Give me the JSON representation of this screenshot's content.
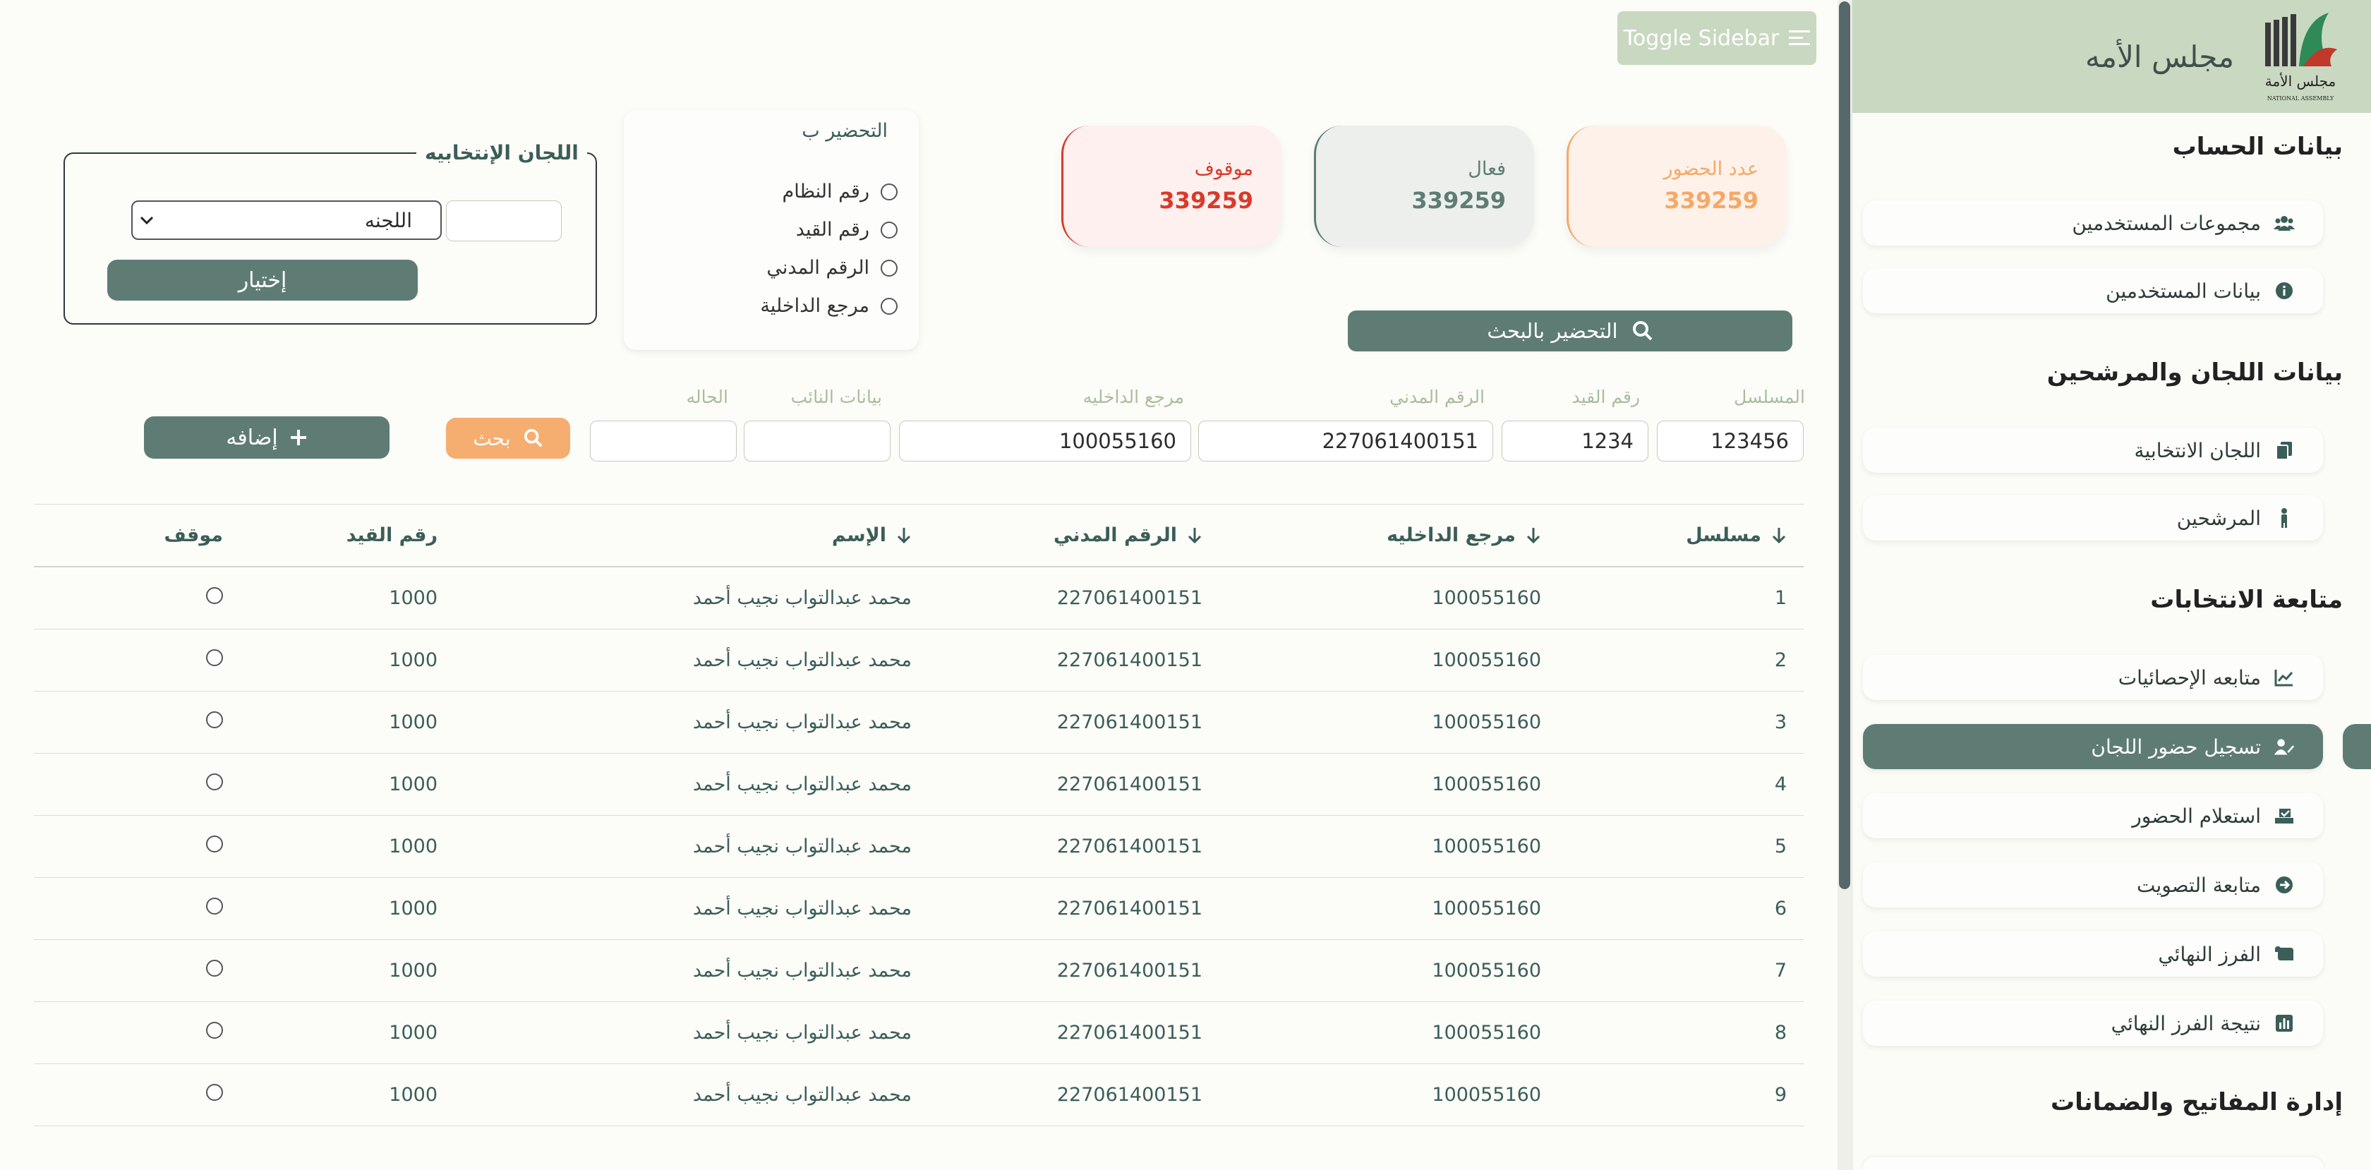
{
  "brand": {
    "title": "مجلس الأمه",
    "logo_text": "مجلس الأمة",
    "logo_subtext": "NATIONAL ASSEMBLY"
  },
  "sidebar": {
    "sections": [
      {
        "title": "بيانات الحساب"
      },
      {
        "title": "بيانات اللجان والمرشحين"
      },
      {
        "title": "متابعة الانتخابات"
      },
      {
        "title": "إدارة المفاتيح والضمانات"
      }
    ],
    "items": [
      {
        "label": "مجموعات المستخدمين",
        "icon": "users-icon"
      },
      {
        "label": "بيانات المستخدمين",
        "icon": "info-icon"
      },
      {
        "label": "اللجان الانتخابية",
        "icon": "copy-icon"
      },
      {
        "label": "المرشحين",
        "icon": "person-icon"
      },
      {
        "label": "متابعه الإحصائيات",
        "icon": "chart-line-icon"
      },
      {
        "label": "تسجيل حضور اللجان",
        "icon": "user-edit-icon",
        "active": true
      },
      {
        "label": "استعلام الحضور",
        "icon": "check-tray-icon"
      },
      {
        "label": "متابعة التصويت",
        "icon": "arrow-circle-icon"
      },
      {
        "label": "الفرز النهائي",
        "icon": "scroll-icon"
      },
      {
        "label": "نتيجة الفرز النهائي",
        "icon": "bar-chart-icon"
      }
    ]
  },
  "toolbar": {
    "toggle_label": "Toggle Sidebar"
  },
  "stats": [
    {
      "label": "عدد الحضور",
      "value": "339259",
      "color": "#f6a866"
    },
    {
      "label": "فعال",
      "value": "339259",
      "color": "#5e7c74"
    },
    {
      "label": "موقوف",
      "value": "339259",
      "color": "#d93a2b"
    }
  ],
  "search_prep_button": "التحضير بالبحث",
  "prep_by": {
    "title": "التحضير ب",
    "options": [
      "رقم النظام",
      "رقم القيد",
      "الرقم المدني",
      "مرجع الداخلية"
    ]
  },
  "committees": {
    "legend": "اللجان الإنتخابيه",
    "select_value": "اللجنه",
    "choose_label": "إختيار"
  },
  "filters": {
    "labels": {
      "serial": "المسلسل",
      "reg": "رقم القيد",
      "civil": "الرقم المدني",
      "ref": "مرجع الداخليه",
      "deputy": "بيانات النائب",
      "status": "الحاله"
    },
    "values": {
      "serial": "123456",
      "reg": "1234",
      "civil": "227061400151",
      "ref": "100055160",
      "deputy": "",
      "status": ""
    },
    "search_label": "بحث",
    "add_label": "إضافه"
  },
  "table": {
    "headers": {
      "serial": "مسلسل",
      "ref": "مرجع الداخليه",
      "civil": "الرقم المدني",
      "name": "الإسم",
      "reg": "رقم القيد",
      "stop": "موقف"
    },
    "rows": [
      {
        "serial": "1",
        "ref": "100055160",
        "civil": "227061400151",
        "name": "محمد عبدالتواب نجيب أحمد",
        "reg": "1000"
      },
      {
        "serial": "2",
        "ref": "100055160",
        "civil": "227061400151",
        "name": "محمد عبدالتواب نجيب أحمد",
        "reg": "1000"
      },
      {
        "serial": "3",
        "ref": "100055160",
        "civil": "227061400151",
        "name": "محمد عبدالتواب نجيب أحمد",
        "reg": "1000"
      },
      {
        "serial": "4",
        "ref": "100055160",
        "civil": "227061400151",
        "name": "محمد عبدالتواب نجيب أحمد",
        "reg": "1000"
      },
      {
        "serial": "5",
        "ref": "100055160",
        "civil": "227061400151",
        "name": "محمد عبدالتواب نجيب أحمد",
        "reg": "1000"
      },
      {
        "serial": "6",
        "ref": "100055160",
        "civil": "227061400151",
        "name": "محمد عبدالتواب نجيب أحمد",
        "reg": "1000"
      },
      {
        "serial": "7",
        "ref": "100055160",
        "civil": "227061400151",
        "name": "محمد عبدالتواب نجيب أحمد",
        "reg": "1000"
      },
      {
        "serial": "8",
        "ref": "100055160",
        "civil": "227061400151",
        "name": "محمد عبدالتواب نجيب أحمد",
        "reg": "1000"
      },
      {
        "serial": "9",
        "ref": "100055160",
        "civil": "227061400151",
        "name": "محمد عبدالتواب نجيب أحمد",
        "reg": "1000"
      }
    ]
  }
}
